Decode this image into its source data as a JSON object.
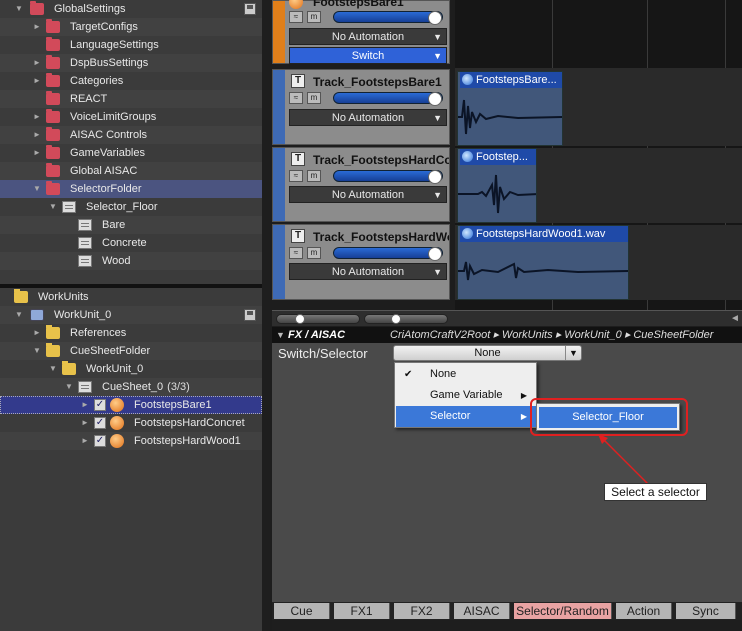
{
  "global_tree": {
    "root": "GlobalSettings",
    "items": [
      {
        "label": "TargetConfigs"
      },
      {
        "label": "LanguageSettings"
      },
      {
        "label": "DspBusSettings"
      },
      {
        "label": "Categories"
      },
      {
        "label": "REACT"
      },
      {
        "label": "VoiceLimitGroups"
      },
      {
        "label": "AISAC Controls"
      },
      {
        "label": "GameVariables"
      },
      {
        "label": "Global AISAC"
      },
      {
        "label": "SelectorFolder"
      }
    ],
    "selector": "Selector_Floor",
    "selector_items": [
      "Bare",
      "Concrete",
      "Wood"
    ]
  },
  "work_tree": {
    "root": "WorkUnits",
    "unit": "WorkUnit_0",
    "references": "References",
    "cuesheet_folder": "CueSheetFolder",
    "sub_unit": "WorkUnit_0",
    "cuesheet": "CueSheet_0",
    "cuesheet_count": "(3/3)",
    "cues": [
      "FootstepsBare1",
      "FootstepsHardConcret",
      "FootstepsHardWood1"
    ]
  },
  "tracks": [
    {
      "name": "FootstepsBare1",
      "automation": "No Automation",
      "switch": "Switch"
    },
    {
      "name": "Track_FootstepsBare1",
      "automation": "No Automation",
      "clip": "FootstepsBare..."
    },
    {
      "name": "Track_FootstepsHardCo...",
      "automation": "No Automation",
      "clip": "Footstep..."
    },
    {
      "name": "Track_FootstepsHardWo...",
      "automation": "No Automation",
      "clip": "FootstepsHardWood1.wav"
    }
  ],
  "fx_panel": {
    "title": "FX / AISAC",
    "breadcrumb": "CriAtomCraftV2Root ▸ WorkUnits ▸ WorkUnit_0 ▸ CueSheetFolder",
    "switch_label": "Switch/Selector",
    "combo_value": "None"
  },
  "menu": {
    "items": [
      "None",
      "Game Variable",
      "Selector"
    ],
    "submenu_item": "Selector_Floor"
  },
  "callout": "Select a selector",
  "tabs": [
    "Cue",
    "FX1",
    "FX2",
    "AISAC",
    "Selector/Random",
    "Action",
    "Sync"
  ],
  "colors": {
    "accent_blue": "#3b78d8",
    "highlight_red": "#e02020",
    "active_tab": "#e9a3a3"
  }
}
